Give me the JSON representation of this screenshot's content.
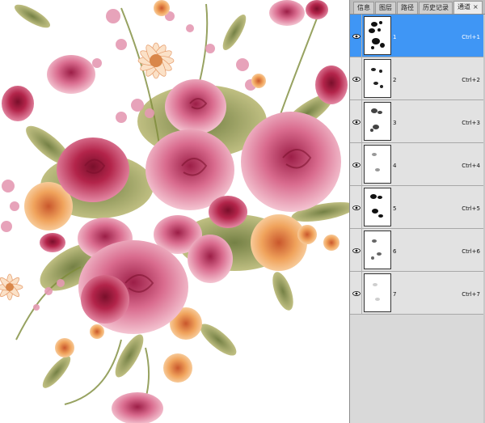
{
  "panel": {
    "tabs": [
      {
        "label": "信息",
        "active": false
      },
      {
        "label": "图层",
        "active": false
      },
      {
        "label": "路径",
        "active": false
      },
      {
        "label": "历史记录",
        "active": false
      },
      {
        "label": "通道",
        "active": true
      }
    ],
    "close_glyph": "×",
    "channels": [
      {
        "name": "1",
        "shortcut": "Ctrl+1",
        "selected": true
      },
      {
        "name": "2",
        "shortcut": "Ctrl+2",
        "selected": false
      },
      {
        "name": "3",
        "shortcut": "Ctrl+3",
        "selected": false
      },
      {
        "name": "4",
        "shortcut": "Ctrl+4",
        "selected": false
      },
      {
        "name": "5",
        "shortcut": "Ctrl+5",
        "selected": false
      },
      {
        "name": "6",
        "shortcut": "Ctrl+6",
        "selected": false
      },
      {
        "name": "7",
        "shortcut": "Ctrl+7",
        "selected": false
      }
    ],
    "visibility_icon": "eye-icon"
  },
  "colors": {
    "selection": "#3f96f5",
    "rose_deep": "#b3244a",
    "rose_pink": "#d96b8e",
    "rose_light": "#efb5c4",
    "peach": "#f0a35c",
    "leaf": "#7e8c3a",
    "leaf_light": "#c7c37b"
  }
}
